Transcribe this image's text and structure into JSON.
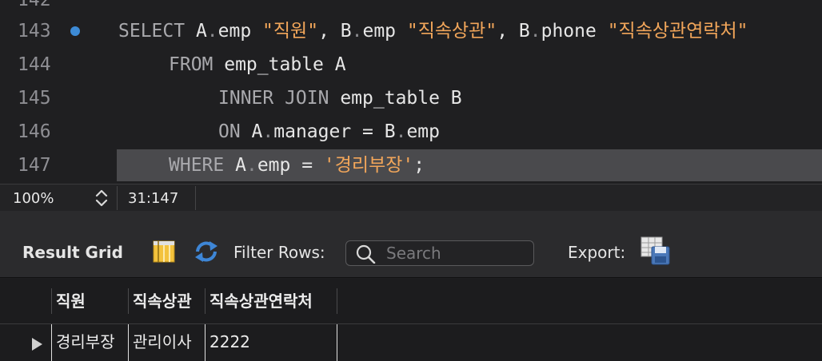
{
  "editor": {
    "lines": [
      {
        "number": "142"
      },
      {
        "number": "143",
        "has_marker": true,
        "kw1": "SELECT",
        "t1": " A",
        "d1": ".",
        "t2": "emp ",
        "s1": "\"직원\"",
        "t3": ", B",
        "d2": ".",
        "t4": "emp ",
        "s2": "\"직속상관\"",
        "t5": ", B",
        "d3": ".",
        "t6": "phone ",
        "s3": "\"직속상관연락처\""
      },
      {
        "number": "144",
        "kw1": "FROM",
        "t1": " emp_table A"
      },
      {
        "number": "145",
        "kw1": "INNER JOIN",
        "t1": " emp_table B"
      },
      {
        "number": "146",
        "kw1": "ON",
        "t1": " A",
        "d1": ".",
        "t2": "manager = B",
        "d2": ".",
        "t3": "emp"
      },
      {
        "number": "147",
        "current": true,
        "kw1": "WHERE",
        "t1": " A",
        "d1": ".",
        "t2": "emp = ",
        "s1": "'경리부장'",
        "t3": ";"
      }
    ]
  },
  "statusbar": {
    "zoom": "100%",
    "cursor_position": "31:147"
  },
  "toolbar": {
    "result_grid_label": "Result Grid",
    "filter_rows_label": "Filter Rows:",
    "search_placeholder": "Search",
    "export_label": "Export:"
  },
  "grid": {
    "columns": [
      "직원",
      "직속상관",
      "직속상관연락처"
    ],
    "rows": [
      [
        "경리부장",
        "관리이사",
        "2222"
      ]
    ]
  },
  "colors": {
    "keyword": "#a9a9ad",
    "string": "#f2a65a",
    "marker": "#3d8bd6",
    "current_line": "#4a4a4d"
  },
  "icons": [
    "breakpoint-marker-icon",
    "stepper-icon",
    "grid-view-icon",
    "refresh-icon",
    "search-icon",
    "export-icon",
    "row-pointer-icon"
  ]
}
